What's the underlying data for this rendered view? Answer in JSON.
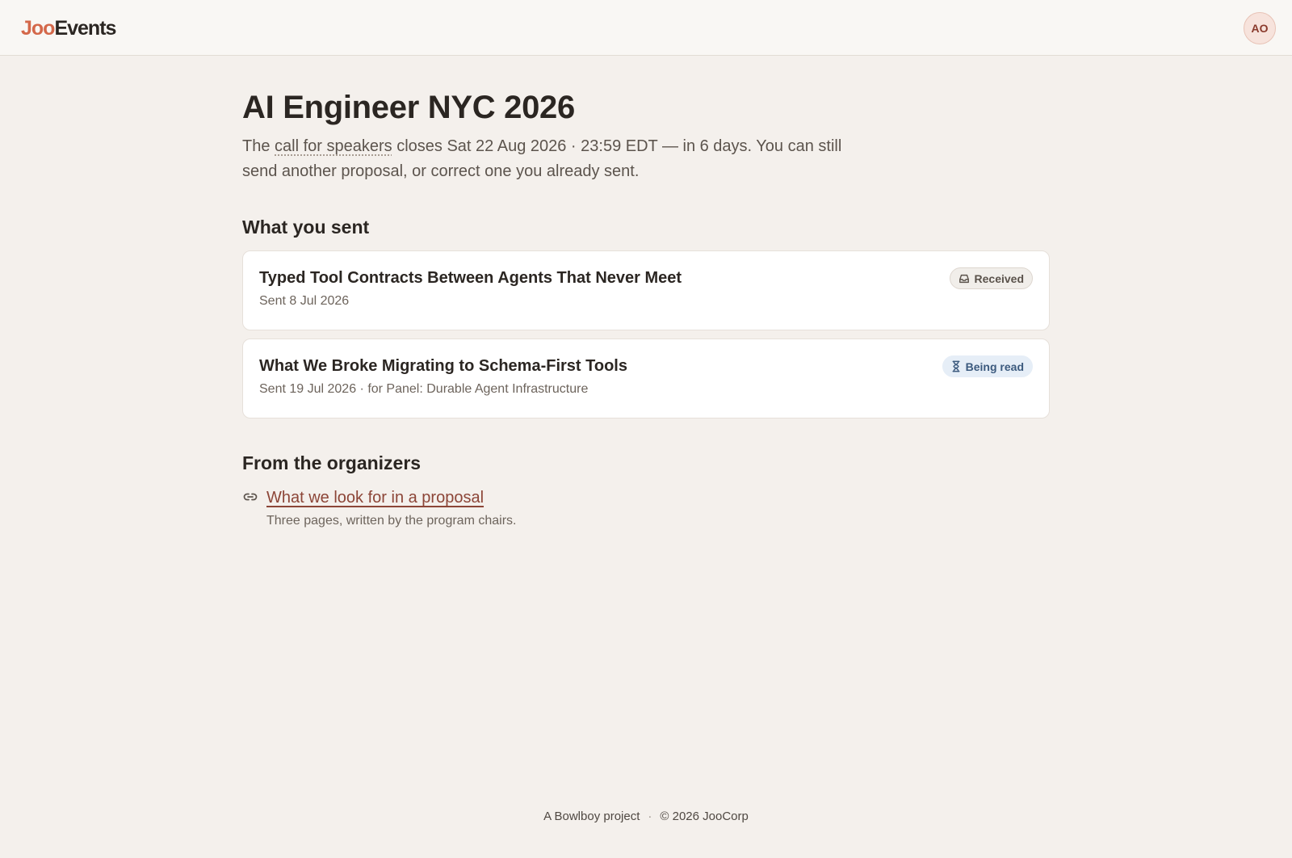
{
  "header": {
    "logo_brand": "Joo",
    "logo_product": "Events",
    "avatar_initials": "AO"
  },
  "event": {
    "title": "AI Engineer NYC 2026",
    "lede_prefix": "The ",
    "lede_term": "call for speakers",
    "lede_rest": " closes Sat 22 Aug 2026 · 23:59 EDT — in 6 days. You can still send another proposal, or correct one you already sent."
  },
  "sent": {
    "heading": "What you sent",
    "items": [
      {
        "title": "Typed Tool Contracts Between Agents That Never Meet",
        "meta": "Sent 8 Jul 2026",
        "status": "Received",
        "status_icon": "inbox-icon"
      },
      {
        "title": "What We Broke Migrating to Schema-First Tools",
        "meta": "Sent 19 Jul 2026 · for Panel: Durable Agent Infrastructure",
        "status": "Being read",
        "status_icon": "hourglass-icon"
      }
    ]
  },
  "organizers": {
    "heading": "From the organizers",
    "link_label": "What we look for in a proposal",
    "link_description": "Three pages, written by the program chairs.",
    "link_icon": "link-icon"
  },
  "footer": {
    "project": "A Bowlboy project",
    "separator": "·",
    "copyright": "© 2026 JooCorp"
  },
  "colors": {
    "background": "#f4f0ec",
    "accent": "#d4684a",
    "link": "#8c4537",
    "received_badge": "#f1eeea",
    "reading_badge": "#e6eef7"
  }
}
